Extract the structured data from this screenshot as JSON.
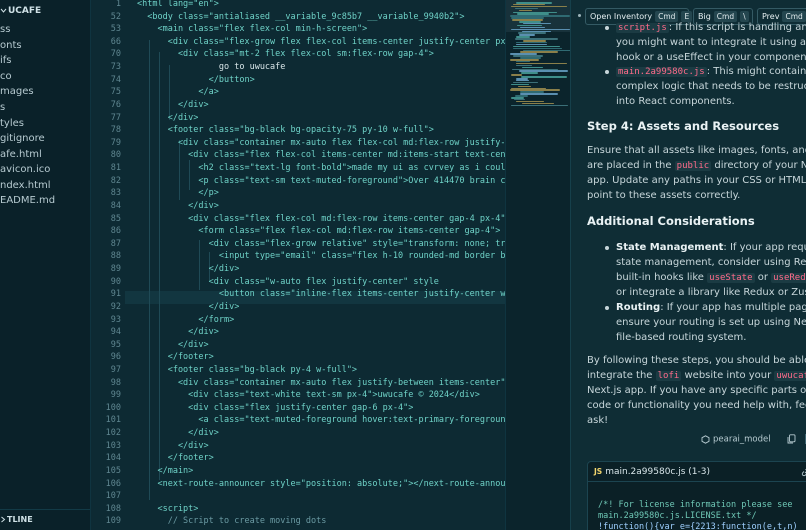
{
  "sidebar": {
    "root": "UCAFE",
    "files": [
      "ss",
      "onts",
      "ifs",
      "co",
      "mages",
      "s",
      "tyles",
      "gitignore",
      "afe.html",
      "avicon.ico",
      "ndex.html",
      "EADME.md"
    ],
    "outline": "TLINE"
  },
  "editor": {
    "lines": [
      {
        "n": "1",
        "t": "<html lang=\"en\">"
      },
      {
        "n": "52",
        "t": "  <body class=\"antialiased __variable_9c85b7 __variable_9940b2\">"
      },
      {
        "n": "53",
        "t": "    <main class=\"flex flex-col min-h-screen\">"
      },
      {
        "n": "66",
        "t": "      <div class=\"flex-grow flex flex-col items-center justify-center px"
      },
      {
        "n": "70",
        "t": "        <div class=\"mt-2 flex flex-col sm:flex-row gap-4\">"
      },
      {
        "n": "73",
        "t": "                go to uwucafe"
      },
      {
        "n": "74",
        "t": "              </button>"
      },
      {
        "n": "75",
        "t": "            </a>"
      },
      {
        "n": "76",
        "t": "        </div>"
      },
      {
        "n": "77",
        "t": "      </div>"
      },
      {
        "n": "78",
        "t": "      <footer class=\"bg-black bg-opacity-75 py-10 w-full\">"
      },
      {
        "n": "79",
        "t": "        <div class=\"container mx-auto flex flex-col md:flex-row justify-"
      },
      {
        "n": "80",
        "t": "          <div class=\"flex flex-col items-center md:items-start text-cen"
      },
      {
        "n": "81",
        "t": "            <h2 class=\"text-lg font-bold\">made my ui as cvrvey as i coul"
      },
      {
        "n": "82",
        "t": "            <p class=\"text-sm text-muted-foreground\">Over 414470 brain c"
      },
      {
        "n": "83",
        "t": "            </p>"
      },
      {
        "n": "84",
        "t": "          </div>"
      },
      {
        "n": "85",
        "t": "          <div class=\"flex flex-col md:flex-row items-center gap-4 px-4\""
      },
      {
        "n": "86",
        "t": "            <form class=\"flex flex-col md:flex-row items-center gap-4\">"
      },
      {
        "n": "87",
        "t": "              <div class=\"flex-grow relative\" style=\"transform: none; tr"
      },
      {
        "n": "88",
        "t": "                <input type=\"email\" class=\"flex h-10 rounded-md border b"
      },
      {
        "n": "89",
        "t": "              </div>"
      },
      {
        "n": "90",
        "t": "              <div class=\"w-auto flex justify-center\" style"
      },
      {
        "n": "91",
        "t": "                <button class=\"inline-flex items-center justify-center w"
      },
      {
        "n": "92",
        "t": "              </div>"
      },
      {
        "n": "93",
        "t": "            </form>"
      },
      {
        "n": "94",
        "t": "          </div>"
      },
      {
        "n": "95",
        "t": "        </div>"
      },
      {
        "n": "96",
        "t": "      </footer>"
      },
      {
        "n": "97",
        "t": "      <footer class=\"bg-black py-4 w-full\">"
      },
      {
        "n": "98",
        "t": "        <div class=\"container mx-auto flex justify-between items-center\""
      },
      {
        "n": "99",
        "t": "          <div class=\"text-white text-sm px-4\">uwucafe © 2024</div>"
      },
      {
        "n": "100",
        "t": "          <div class=\"flex justify-center gap-6 px-4\">"
      },
      {
        "n": "101",
        "t": "            <a class=\"text-muted-foreground hover:text-primary-foregroun"
      },
      {
        "n": "102",
        "t": "          </div>"
      },
      {
        "n": "103",
        "t": "        </div>"
      },
      {
        "n": "104",
        "t": "      </footer>"
      },
      {
        "n": "105",
        "t": "    </main>"
      },
      {
        "n": "106",
        "t": "    <next-route-announcer style=\"position: absolute;\"></next-route-annou"
      },
      {
        "n": "107",
        "t": ""
      },
      {
        "n": "108",
        "t": "    <script>"
      },
      {
        "n": "109",
        "t": "      // Script to create moving dots"
      }
    ]
  },
  "toolbar": {
    "open_inventory": "Open Inventory",
    "open_inventory_k1": "Cmd",
    "open_inventory_k2": "E",
    "big": "Big",
    "big_k1": "Cmd",
    "big_k2": "\\",
    "prev": "Prev",
    "prev_k1": "Cmd"
  },
  "chat": {
    "b1_code": "script.js",
    "b1_text": ": If this script is handling analyt",
    "b1_l2": "you might want to integrate it using a custo",
    "b1_l3": "hook or a useEffect in your component.",
    "b2_code": "main.2a99580c.js",
    "b2_text": ": This might contain mo",
    "b2_l2": "complex logic that needs to be restructure",
    "b2_l3": "into React components.",
    "h_assets": "Step 4: Assets and Resources",
    "p1_l1": "Ensure that all assets like images, fonts, and icon",
    "p1_l2a": "are placed in the ",
    "p1_l2_code": "public",
    "p1_l2b": " directory of your Next.js",
    "p1_l3": "app. Update any paths in your CSS or HTML to",
    "p1_l4": "point to these assets correctly.",
    "h_additional": "Additional Considerations",
    "b3_title": "State Management",
    "b3_text": ": If your app requires",
    "b3_l2": "state management, consider using React's",
    "b3_l3a": "built-in hooks like ",
    "b3_l3_code1": "useState",
    "b3_l3b": " or ",
    "b3_l3_code2": "useReduce",
    "b3_l4": "or integrate a library like Redux or Zustanc",
    "b4_title": "Routing",
    "b4_text": ": If your app has multiple pages,",
    "b4_l2": "ensure your routing is set up using Next.js",
    "b4_l3": "file-based routing system.",
    "p2_l1": "By following these steps, you should be able to",
    "p2_l2a": "integrate the ",
    "p2_l2_code1": "lofi",
    "p2_l2b": " website into your ",
    "p2_l2_code2": "uwucafe",
    "p2_l3": "Next.js app. If you have any specific parts of the",
    "p2_l4": "code or functionality you need help with, feel fre",
    "p2_l5": "ask!",
    "author": "pearai_model",
    "codeblock_title": "main.2a99580c.js (1-3)",
    "codeblock_lang": "JS",
    "cb_l1": "/*! For license information please see",
    "cb_l2": "main.2a99580c.js.LICENSE.txt */",
    "cb_l3": "!function(){var e={2213:function(e,t,n)"
  },
  "colors": {
    "tag": "#6fd3c8",
    "attr": "#9fd0ff",
    "string": "#f5d76e",
    "comment": "#6b9aa3",
    "inline_code": "#ff6b8a"
  }
}
